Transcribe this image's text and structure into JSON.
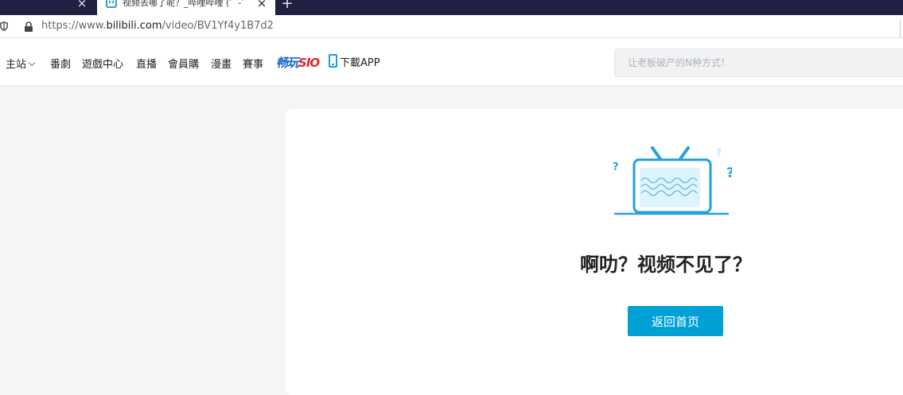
{
  "browser": {
    "tabs": [
      {
        "title": "",
        "active": false
      },
      {
        "title": "视频去哪了呢？_哔哩哔哩 (゜-゜)つロ 干杯~-bilibili",
        "active": true
      }
    ],
    "close_glyph": "×",
    "new_tab_glyph": "+",
    "url": {
      "prefix": "https://www.",
      "host": "bilibili.com",
      "path": "/video/BV1Yf4y1B7d2"
    }
  },
  "nav": {
    "main": "主站",
    "items": [
      "番劇",
      "遊戲中心",
      "直播",
      "會員購",
      "漫畫",
      "賽事"
    ],
    "brand": {
      "part1": "畅玩",
      "part2": "SIO"
    },
    "download": "下載APP"
  },
  "search": {
    "placeholder": "让老板破产的N种方式！"
  },
  "error": {
    "title": "啊叻？视频不见了？",
    "button": "返回首页"
  },
  "colors": {
    "accent": "#00a1d6",
    "tabbar": "#1f2042",
    "brand_blue": "#1466c8",
    "brand_red": "#e5262b"
  },
  "icons": [
    "shield-icon",
    "lock-icon",
    "chevron-down-icon",
    "phone-icon",
    "tv-icon",
    "close-icon",
    "plus-icon"
  ]
}
